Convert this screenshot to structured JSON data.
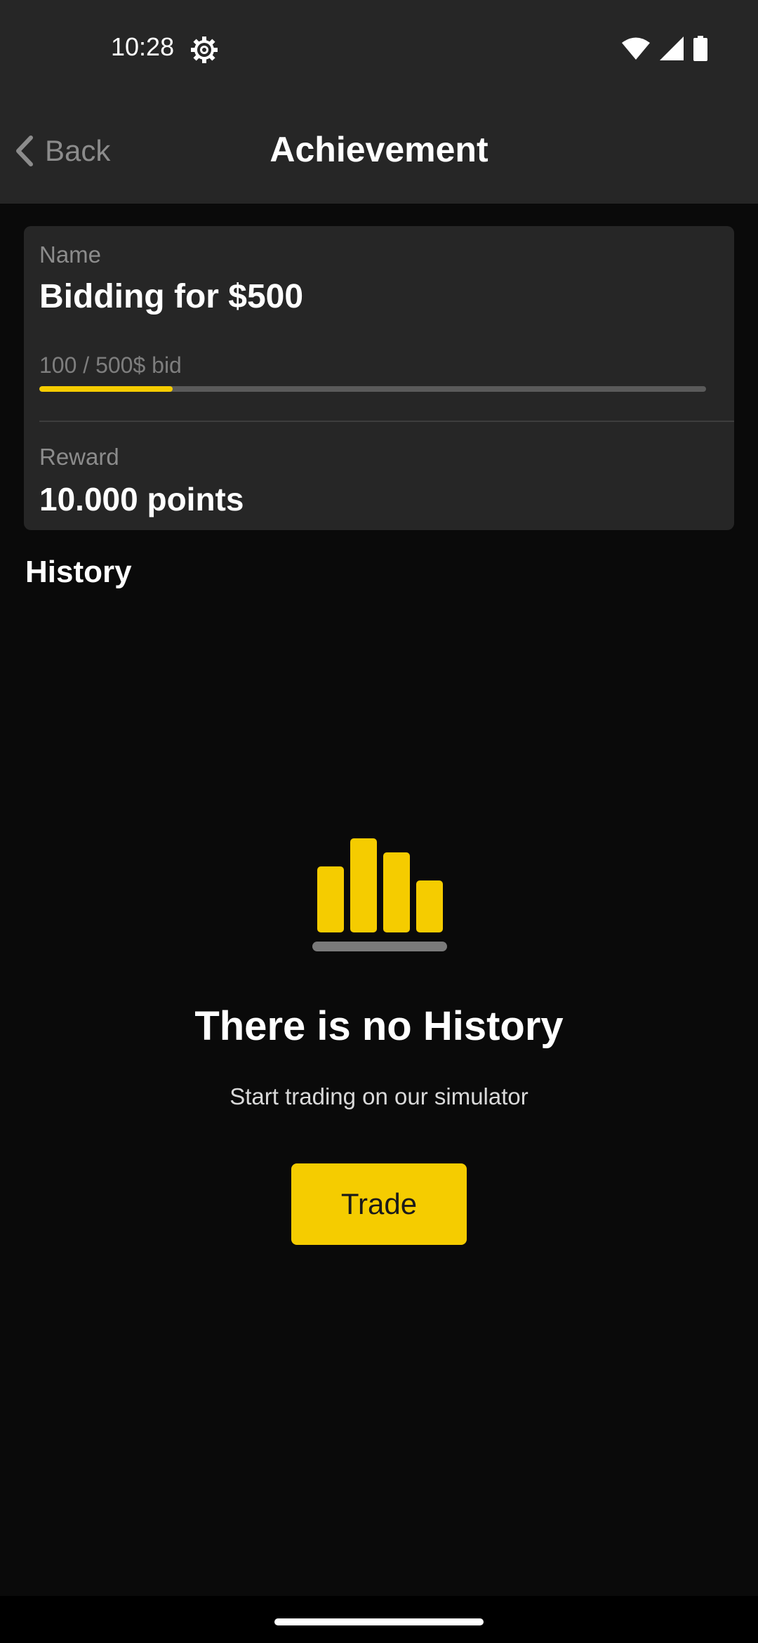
{
  "status_bar": {
    "time": "10:28",
    "icons": [
      "settings-gear-icon",
      "wifi-icon",
      "cell-signal-icon",
      "battery-icon"
    ]
  },
  "app_bar": {
    "back_label": "Back",
    "title": "Achievement",
    "back_icon": "chevron-left-icon"
  },
  "achievement": {
    "name_label": "Name",
    "name": "Bidding for $500",
    "progress_text": "100 / 500$ bid",
    "progress_fraction": 0.2,
    "reward_label": "Reward",
    "reward": "10.000 points"
  },
  "history": {
    "heading": "History",
    "empty_icon": "bar-chart-icon",
    "empty_title": "There is no History",
    "empty_subtitle": "Start trading on our simulator",
    "trade_button": "Trade"
  },
  "colors": {
    "accent": "#f5cc00",
    "background": "#0a0a0a",
    "surface": "#262626",
    "muted_text": "#8c8c8c"
  }
}
